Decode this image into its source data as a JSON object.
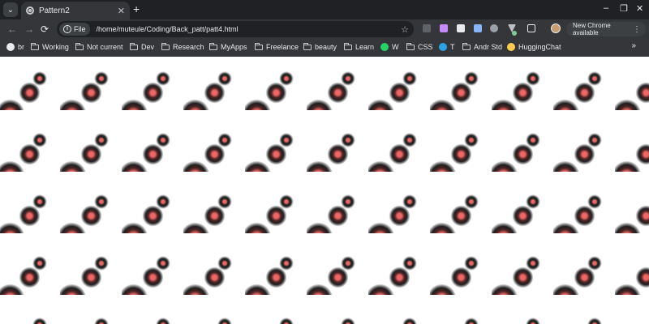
{
  "window": {
    "tab_title": "Pattern2",
    "new_tab_symbol": "+",
    "tab_search_symbol": "⌄",
    "close_symbol": "✕",
    "minimize_symbol": "–",
    "restore_symbol": "❐",
    "window_close_symbol": "✕"
  },
  "toolbar": {
    "back_symbol": "←",
    "forward_symbol": "→",
    "reload_symbol": "⟳",
    "scheme_chip": "File",
    "url": "/home/muteule/Coding/Back_patt/patt4.html",
    "bookmark_star": "☆",
    "update_button": "New Chrome available",
    "menu_symbol": "⋮",
    "extensions": [
      {
        "name": "extension-dark-icon",
        "color": "#5f6368"
      },
      {
        "name": "extension-purple-icon",
        "color": "#c58af9"
      },
      {
        "name": "extension-calendar-icon",
        "color": "#e8eaed"
      },
      {
        "name": "extension-translate-icon",
        "color": "#8ab4f8"
      },
      {
        "name": "extension-grey-icon",
        "color": "#9aa0a6"
      },
      {
        "name": "extension-v-icon",
        "color": "#bdc1c6"
      },
      {
        "name": "extension-colorzilla-icon",
        "color": "#81c995"
      },
      {
        "name": "extensions-puzzle-icon",
        "color": "#e8eaed"
      }
    ]
  },
  "bookmarks": [
    {
      "label": "br",
      "icon": "globe-icon"
    },
    {
      "label": "Working",
      "icon": "folder-icon"
    },
    {
      "label": "Not current",
      "icon": "folder-icon"
    },
    {
      "label": "Dev",
      "icon": "folder-icon"
    },
    {
      "label": "Research",
      "icon": "folder-icon"
    },
    {
      "label": "MyApps",
      "icon": "folder-icon"
    },
    {
      "label": "Freelance",
      "icon": "folder-icon"
    },
    {
      "label": "beauty",
      "icon": "folder-icon"
    },
    {
      "label": "Learn",
      "icon": "folder-icon"
    },
    {
      "label": "W",
      "icon": "whatsapp-icon"
    },
    {
      "label": "CSS",
      "icon": "folder-icon"
    },
    {
      "label": "T",
      "icon": "telegram-icon"
    },
    {
      "label": "Andr Std",
      "icon": "folder-icon"
    },
    {
      "label": "HuggingChat",
      "icon": "huggingface-icon"
    }
  ],
  "bookmarks_more_symbol": "»",
  "pattern": {
    "dot_color": "#f06a69",
    "ring_color": "#1f1f1f",
    "background_color": "#ffffff"
  }
}
